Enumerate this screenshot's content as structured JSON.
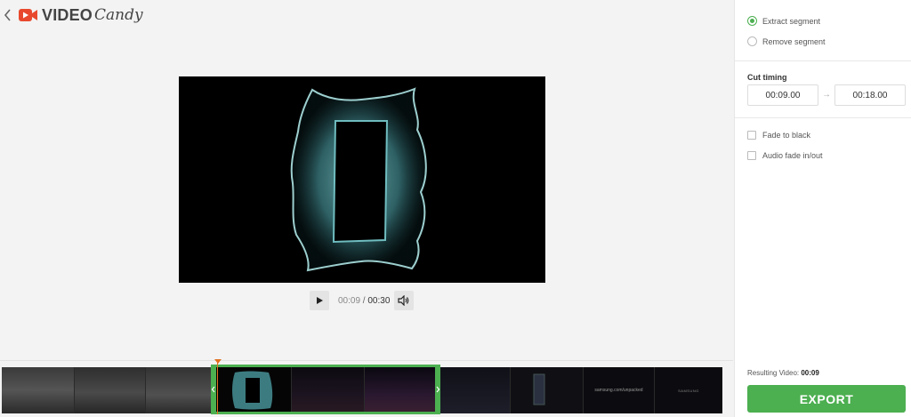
{
  "header": {
    "logo_video": "VIDEO",
    "logo_candy": "Candy"
  },
  "player": {
    "current_time": "00:09",
    "separator": " / ",
    "total_time": "00:30"
  },
  "sidebar": {
    "mode_options": [
      {
        "label": "Extract segment",
        "selected": true
      },
      {
        "label": "Remove segment",
        "selected": false
      }
    ],
    "cut_timing_title": "Cut timing",
    "start_time": "00:09.00",
    "arrow": "→",
    "end_time": "00:18.00",
    "checkboxes": [
      {
        "label": "Fade to black",
        "checked": false
      },
      {
        "label": "Audio fade in/out",
        "checked": false
      }
    ],
    "result_label": "Resulting Video:",
    "result_value": "00:09",
    "export_label": "EXPORT"
  },
  "timeline": {
    "frame_texts": {
      "url": "samsung.com/unpacked",
      "brand": "SAMSUNG"
    }
  },
  "colors": {
    "accent": "#4caf50",
    "logo_red": "#e8492e",
    "playhead": "#e07020"
  }
}
